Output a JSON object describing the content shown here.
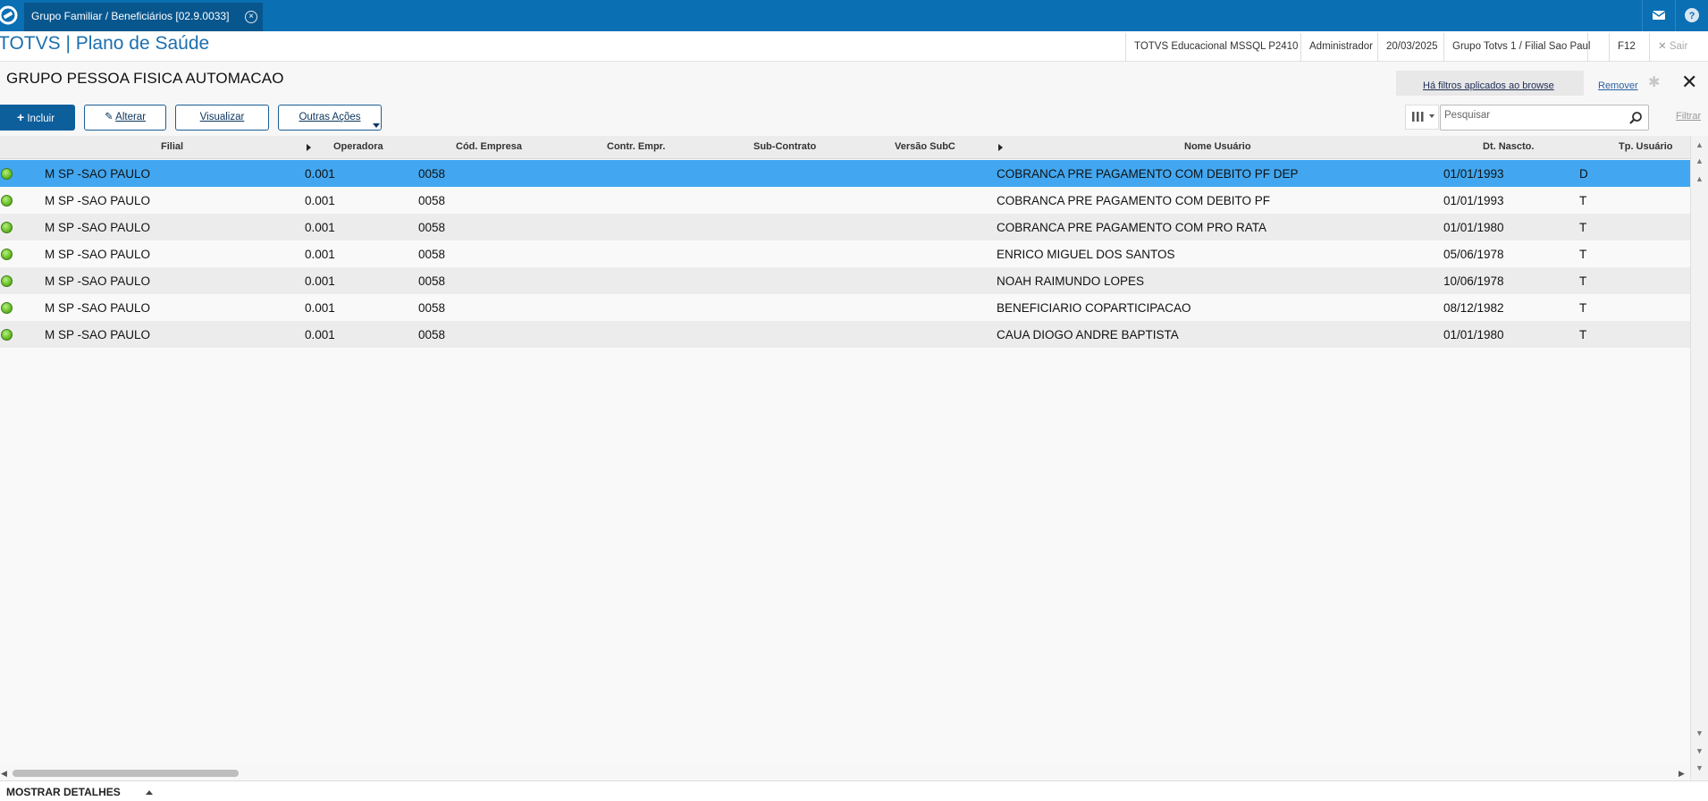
{
  "window": {
    "tab_title": "Grupo Familiar / Beneficiários [02.9.0033]",
    "tab_close_glyph": "×"
  },
  "header": {
    "app_title": "TOTVS | Plano de Saúde",
    "environment": "TOTVS Educacional MSSQL P2410",
    "user": "Administrador",
    "date": "20/03/2025",
    "branch": "Grupo Totvs 1 / Filial Sao Paul",
    "f12": "F12",
    "exit": "Sair"
  },
  "page": {
    "title": "GRUPO PESSOA FISICA AUTOMACAO",
    "filter_notice": "Há filtros aplicados ao browse",
    "filter_remove": "Remover",
    "filter_link": "Filtrar"
  },
  "toolbar": {
    "include": "Incluir",
    "edit": "Alterar",
    "view": "Visualizar",
    "other": "Outras Ações"
  },
  "search": {
    "placeholder": "Pesquisar"
  },
  "grid": {
    "columns": {
      "filial": "Filial",
      "operadora": "Operadora",
      "cod_empresa": "Cód. Empresa",
      "contr_empr": "Contr. Empr.",
      "sub_contrato": "Sub-Contrato",
      "versao_subc": "Versão SubC",
      "nome_usuario": "Nome Usuário",
      "dt_nascto": "Dt. Nascto.",
      "tp_usuario": "Tp. Usuário"
    },
    "rows": [
      {
        "filial": "M SP -SAO PAULO",
        "operadora": "0.001",
        "empresa": "0058",
        "nome": "COBRANCA PRE PAGAMENTO COM DEBITO PF DEP",
        "nascto": "01/01/1993",
        "tipo": "D"
      },
      {
        "filial": "M SP -SAO PAULO",
        "operadora": "0.001",
        "empresa": "0058",
        "nome": "COBRANCA PRE PAGAMENTO COM DEBITO PF",
        "nascto": "01/01/1993",
        "tipo": "T"
      },
      {
        "filial": "M SP -SAO PAULO",
        "operadora": "0.001",
        "empresa": "0058",
        "nome": "COBRANCA PRE PAGAMENTO COM PRO RATA",
        "nascto": "01/01/1980",
        "tipo": "T"
      },
      {
        "filial": "M SP -SAO PAULO",
        "operadora": "0.001",
        "empresa": "0058",
        "nome": "ENRICO MIGUEL DOS SANTOS",
        "nascto": "05/06/1978",
        "tipo": "T"
      },
      {
        "filial": "M SP -SAO PAULO",
        "operadora": "0.001",
        "empresa": "0058",
        "nome": "NOAH RAIMUNDO LOPES",
        "nascto": "10/06/1978",
        "tipo": "T"
      },
      {
        "filial": "M SP -SAO PAULO",
        "operadora": "0.001",
        "empresa": "0058",
        "nome": "BENEFICIARIO COPARTICIPACAO",
        "nascto": "08/12/1982",
        "tipo": "T"
      },
      {
        "filial": "M SP -SAO PAULO",
        "operadora": "0.001",
        "empresa": "0058",
        "nome": "CAUA DIOGO ANDRE BAPTISTA",
        "nascto": "01/01/1980",
        "tipo": "T"
      }
    ]
  },
  "footer": {
    "details": "MOSTRAR DETALHES"
  },
  "colors": {
    "brand": "#0a6fb3",
    "selected_row": "#42a7f0",
    "status_ok": "#6cc12a"
  }
}
